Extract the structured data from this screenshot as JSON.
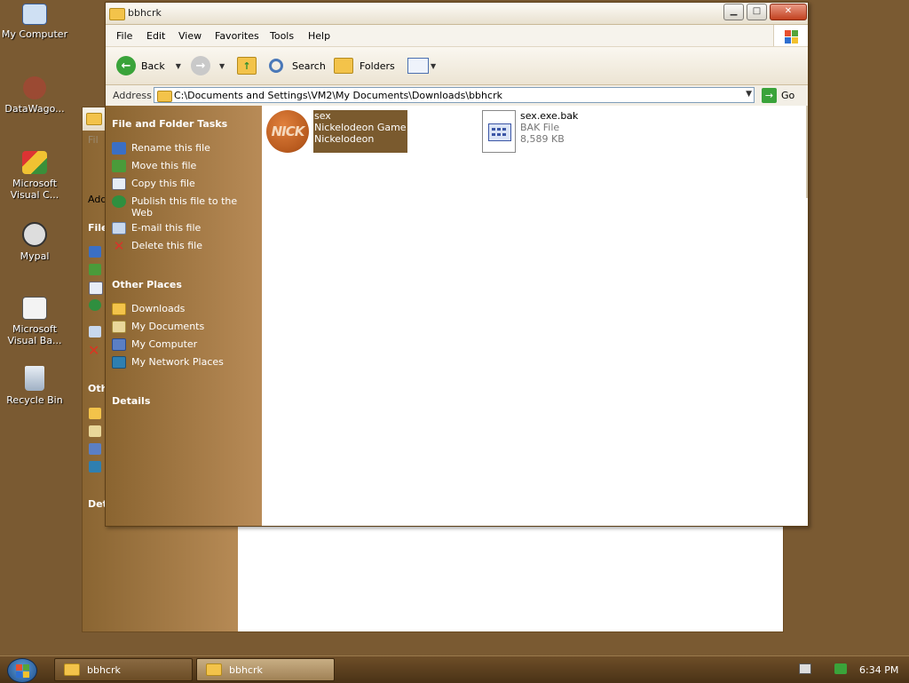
{
  "desktop": {
    "icons": [
      {
        "label": "My Computer",
        "icon": "computer-icon"
      },
      {
        "label": "DataWago...",
        "icon": "datawagon-icon"
      },
      {
        "label": "Microsoft Visual C...",
        "icon": "visual-c-icon"
      },
      {
        "label": "Mypal",
        "icon": "mypal-icon"
      },
      {
        "label": "Microsoft Visual Ba...",
        "icon": "visual-basic-icon"
      },
      {
        "label": "Recycle Bin",
        "icon": "recycle-bin-icon"
      }
    ]
  },
  "back_window": {
    "partial_labels": {
      "menu": "Fil",
      "address": "Add",
      "tasks": "File",
      "other": "Oth",
      "details": "Det"
    }
  },
  "window": {
    "title": "bbhcrk",
    "menu": [
      "File",
      "Edit",
      "View",
      "Favorites",
      "Tools",
      "Help"
    ],
    "toolbar": {
      "back": "Back",
      "search": "Search",
      "folders": "Folders"
    },
    "address": {
      "label": "Address",
      "path": "C:\\Documents and Settings\\VM2\\My Documents\\Downloads\\bbhcrk",
      "go": "Go"
    },
    "task_pane": {
      "file_tasks_title": "File and Folder Tasks",
      "file_tasks": [
        {
          "label": "Rename this file",
          "icon": "rename-icon"
        },
        {
          "label": "Move this file",
          "icon": "move-icon"
        },
        {
          "label": "Copy this file",
          "icon": "copy-icon"
        },
        {
          "label": "Publish this file to the Web",
          "icon": "publish-icon"
        },
        {
          "label": "E-mail this file",
          "icon": "email-icon"
        },
        {
          "label": "Delete this file",
          "icon": "delete-icon"
        }
      ],
      "other_places_title": "Other Places",
      "other_places": [
        {
          "label": "Downloads",
          "icon": "folder-icon"
        },
        {
          "label": "My Documents",
          "icon": "my-documents-icon"
        },
        {
          "label": "My Computer",
          "icon": "my-computer-icon"
        },
        {
          "label": "My Network Places",
          "icon": "network-icon"
        }
      ],
      "details_title": "Details"
    },
    "files": [
      {
        "name": "sex",
        "line2": "Nickelodeon Game",
        "line3": "Nickelodeon",
        "icon_text": "NICK",
        "selected": true
      },
      {
        "name": "sex.exe.bak",
        "line2": "BAK File",
        "line3": "8,589 KB",
        "selected": false
      }
    ]
  },
  "taskbar": {
    "buttons": [
      "bbhcrk",
      "bbhcrk"
    ],
    "clock": "6:34 PM"
  },
  "colors": {
    "desktop": "#7a5a32",
    "task_pane": "#a07540",
    "selection": "#7a5a2e"
  }
}
